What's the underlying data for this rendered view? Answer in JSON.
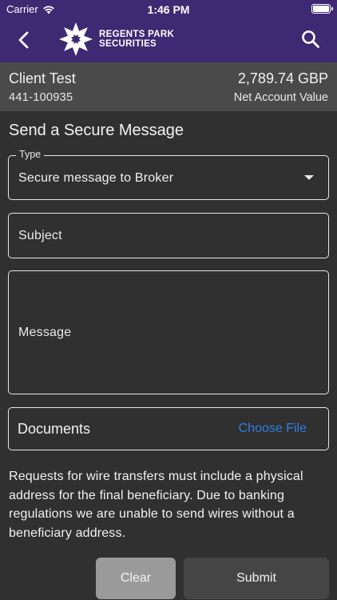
{
  "status_bar": {
    "carrier": "Carrier",
    "time": "1:46 PM"
  },
  "header": {
    "logo_line1": "REGENTS PARK",
    "logo_line2": "SECURITIES",
    "brand_color": "#3e2a72",
    "icons": {
      "back": "chevron-left-icon",
      "search": "search-icon"
    }
  },
  "account": {
    "name": "Client Test",
    "number": "441-100935",
    "value": "2,789.74 GBP",
    "value_label": "Net Account Value"
  },
  "form": {
    "title": "Send a Secure Message",
    "type_label": "Type",
    "type_value": "Secure message to Broker",
    "subject_placeholder": "Subject",
    "message_placeholder": "Message",
    "documents_label": "Documents",
    "choose_file": "Choose File",
    "link_color": "#2f7fe3"
  },
  "notice": "Requests for wire transfers must include a physical address for the final beneficiary. Due to banking regulations we are unable to send wires without a beneficiary address.",
  "buttons": {
    "clear": "Clear",
    "submit": "Submit"
  }
}
